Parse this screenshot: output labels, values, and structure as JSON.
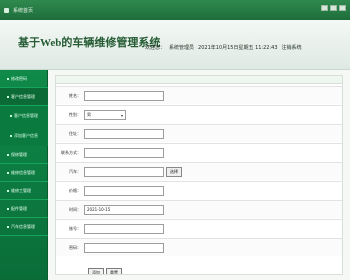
{
  "window": {
    "title": "系统首页"
  },
  "header": {
    "system_title": "基于Web的车辆维修管理系统",
    "welcome_label": "欢迎您：",
    "user_role": "系统管理员",
    "datetime": "2021年10月15日星期五 11:22:43",
    "logout_label": "注销系统"
  },
  "sidebar": {
    "items": [
      {
        "label": "修改密码"
      },
      {
        "label": "客户信息管理"
      }
    ],
    "subitems": [
      {
        "label": "客户信息管理"
      },
      {
        "label": "添加客户信息"
      }
    ],
    "more_items": [
      {
        "label": "保修管理"
      },
      {
        "label": "维修信息管理"
      },
      {
        "label": "维修工管理"
      },
      {
        "label": "配件管理"
      },
      {
        "label": "汽车信息管理"
      }
    ]
  },
  "form": {
    "fields": [
      {
        "label": "姓名：",
        "value": ""
      },
      {
        "label": "性别：",
        "value": "男"
      },
      {
        "label": "住址：",
        "value": ""
      },
      {
        "label": "联系方式：",
        "value": ""
      },
      {
        "label": "汽车：",
        "value": "",
        "button": "选择"
      },
      {
        "label": "价格：",
        "value": ""
      },
      {
        "label": "时间：",
        "value": "2021-10-15"
      },
      {
        "label": "账号：",
        "value": ""
      },
      {
        "label": "密码：",
        "value": ""
      }
    ],
    "buttons": {
      "submit": "添加",
      "reset": "重置"
    }
  }
}
